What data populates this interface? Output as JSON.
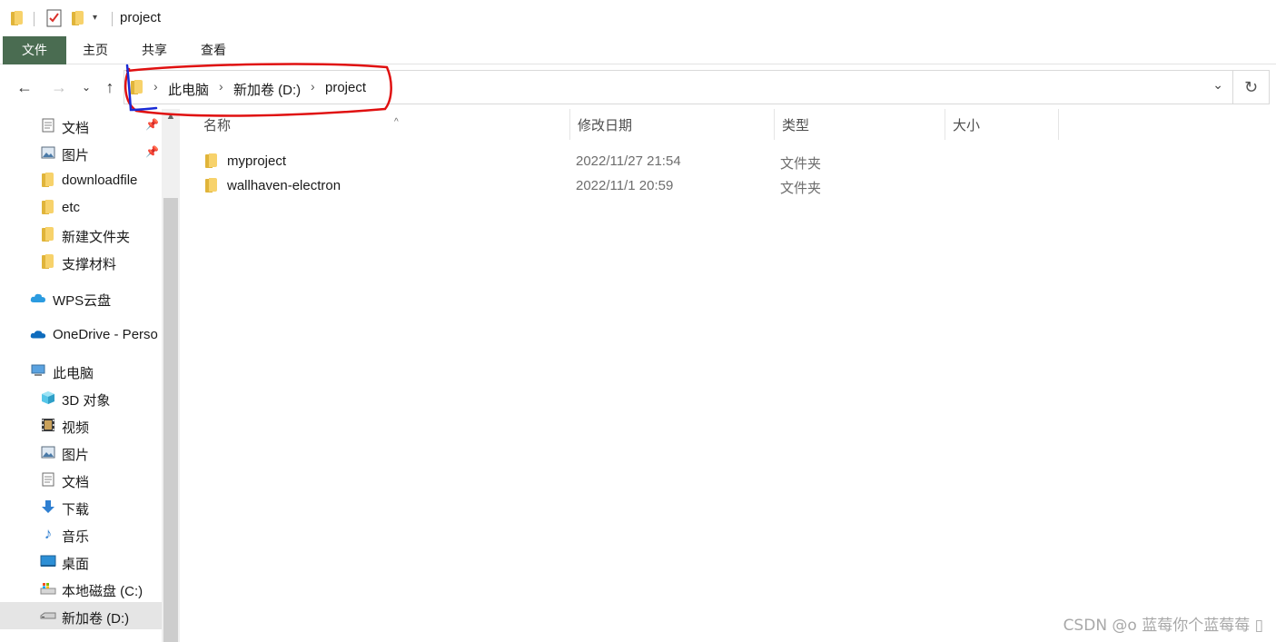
{
  "window": {
    "title": "project",
    "quick_access_icons": [
      "folder-icon",
      "properties-checklist-icon",
      "new-folder-icon",
      "customize-dropdown-icon"
    ]
  },
  "ribbon": {
    "tabs": [
      "文件",
      "主页",
      "共享",
      "查看"
    ]
  },
  "address_bar": {
    "breadcrumb": [
      "此电脑",
      "新加卷 (D:)",
      "project"
    ]
  },
  "sidebar": {
    "items": [
      {
        "label": "文档",
        "icon": "documents-icon",
        "pinned": true
      },
      {
        "label": "图片",
        "icon": "pictures-icon",
        "pinned": true
      },
      {
        "label": "downloadfile",
        "icon": "folder-icon"
      },
      {
        "label": "etc",
        "icon": "folder-icon"
      },
      {
        "label": "新建文件夹",
        "icon": "folder-icon"
      },
      {
        "label": "支撑材料",
        "icon": "folder-icon"
      },
      {
        "label": "WPS云盘",
        "icon": "cloud-icon"
      },
      {
        "label": "OneDrive - Perso",
        "icon": "onedrive-icon"
      },
      {
        "label": "此电脑",
        "icon": "this-pc-icon"
      },
      {
        "label": "3D 对象",
        "icon": "3d-objects-icon"
      },
      {
        "label": "视频",
        "icon": "videos-icon"
      },
      {
        "label": "图片",
        "icon": "pictures-icon"
      },
      {
        "label": "文档",
        "icon": "documents-icon"
      },
      {
        "label": "下载",
        "icon": "downloads-icon"
      },
      {
        "label": "音乐",
        "icon": "music-icon"
      },
      {
        "label": "桌面",
        "icon": "desktop-icon"
      },
      {
        "label": "本地磁盘 (C:)",
        "icon": "local-disk-icon"
      },
      {
        "label": "新加卷 (D:)",
        "icon": "drive-icon",
        "selected": true
      }
    ]
  },
  "file_list": {
    "columns": [
      "名称",
      "修改日期",
      "类型",
      "大小"
    ],
    "rows": [
      {
        "name": "myproject",
        "date": "2022/11/27 21:54",
        "type": "文件夹",
        "size": ""
      },
      {
        "name": "wallhaven-electron",
        "date": "2022/11/1 20:59",
        "type": "文件夹",
        "size": ""
      }
    ]
  },
  "watermark": "CSDN @o 蓝莓你个蓝莓莓 ▯",
  "colors": {
    "file_tab": "#4a6c51",
    "annotation_red": "#e01010",
    "annotation_blue": "#1a2bd6",
    "folder_yellow": "#f7d26b"
  }
}
